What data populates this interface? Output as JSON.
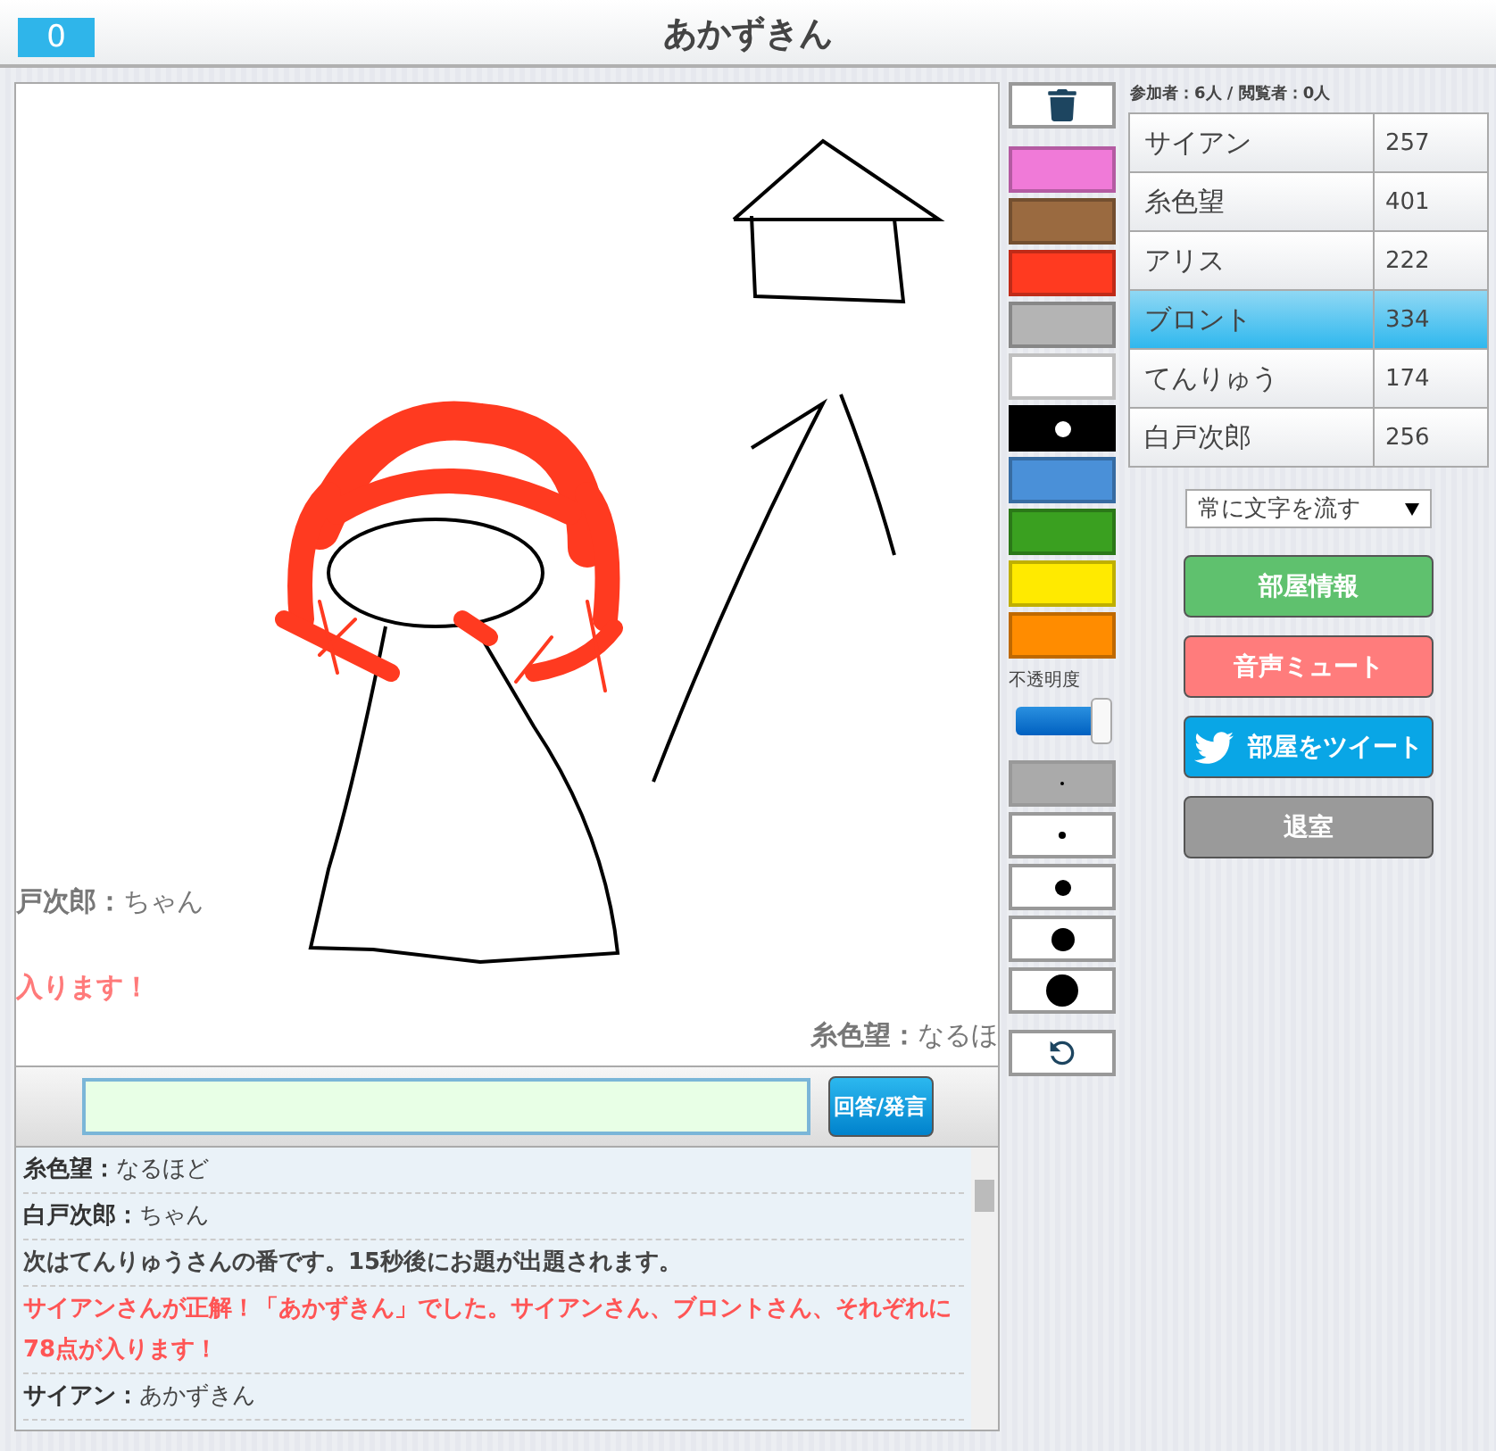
{
  "header": {
    "score": "0",
    "title": "あかずきん"
  },
  "canvas": {
    "comments": [
      {
        "kind": "user",
        "text": "**戸次郎：**ちゃん"
      },
      {
        "kind": "correct",
        "text": "入ります！"
      },
      {
        "kind": "user",
        "text": "**糸色望：**なるほ"
      }
    ]
  },
  "composer": {
    "button": "回答/発言"
  },
  "chat_log": [
    {
      "kind": "user",
      "text": "**糸色望：**なるほど"
    },
    {
      "kind": "user",
      "text": "**白戸次郎：**ちゃん"
    },
    {
      "kind": "system",
      "text": "次はてんりゅうさんの番です。15秒後にお題が出題されます。"
    },
    {
      "kind": "correct",
      "text": "サイアンさんが正解！「あかずきん」でした。サイアンさん、ブロントさん、それぞれに78点が入ります！"
    },
    {
      "kind": "user",
      "text": "**サイアン：**あかずきん"
    }
  ],
  "palette": [
    {
      "color": "#f07ad8",
      "selected": false
    },
    {
      "color": "#9a6a40",
      "selected": false
    },
    {
      "color": "#ff3a20",
      "selected": false
    },
    {
      "color": "#b4b4b4",
      "selected": false
    },
    {
      "color": "#ffffff",
      "selected": false
    },
    {
      "color": "#000000",
      "selected": true
    },
    {
      "color": "#4a90d8",
      "selected": false
    },
    {
      "color": "#3aa020",
      "selected": false
    },
    {
      "color": "#ffea00",
      "selected": false
    },
    {
      "color": "#ff8c00",
      "selected": false
    }
  ],
  "opacity": {
    "label": "不透明度",
    "level": 0.95
  },
  "brush_sizes": [
    {
      "selected": true
    },
    {
      "selected": false
    },
    {
      "selected": false
    },
    {
      "selected": false
    },
    {
      "selected": false
    }
  ],
  "room_counts": "参加者：6人 / 閲覧者：0人",
  "players": [
    {
      "name": "サイアン",
      "score": "257",
      "selected": false
    },
    {
      "name": "糸色望",
      "score": "401",
      "selected": false
    },
    {
      "name": "アリス",
      "score": "222",
      "selected": false
    },
    {
      "name": "ブロント",
      "score": "334",
      "selected": true
    },
    {
      "name": "てんりゅう",
      "score": "174",
      "selected": false
    },
    {
      "name": "白戸次郎",
      "score": "256",
      "selected": false
    }
  ],
  "comment_mode": "常に文字を流す",
  "actions": [
    {
      "kind": "info",
      "label": "部屋情報"
    },
    {
      "kind": "mute",
      "label": "音声ミュート"
    },
    {
      "kind": "tweet",
      "label": "部屋をツイート"
    },
    {
      "kind": "leave",
      "label": "退室"
    }
  ]
}
